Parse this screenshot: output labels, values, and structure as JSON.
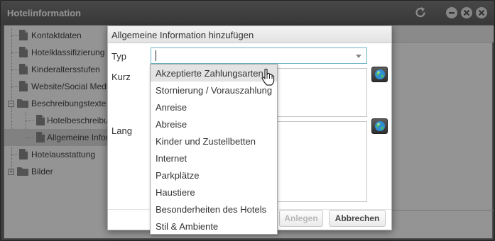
{
  "window": {
    "title": "Hotelinformation"
  },
  "tree": {
    "items": [
      {
        "label": "Kontaktdaten"
      },
      {
        "label": "Hotelklassifizierung"
      },
      {
        "label": "Kinderaltersstufen"
      },
      {
        "label": "Website/Social Media"
      },
      {
        "label": "Beschreibungstexte"
      },
      {
        "label": "Hotelbeschreibung"
      },
      {
        "label": "Allgemeine Informationen"
      },
      {
        "label": "Hotelausstattung"
      },
      {
        "label": "Bilder"
      }
    ]
  },
  "dialog": {
    "title": "Allgemeine Information hinzufügen",
    "type_label": "Typ",
    "type_value": "",
    "short_label": "Kurz",
    "long_label": "Lang",
    "create_button": "Anlegen",
    "cancel_button": "Abbrechen"
  },
  "dropdown": {
    "options": [
      "Akzeptierte Zahlungsarten",
      "Stornierung / Vorauszahlung",
      "Anreise",
      "Abreise",
      "Kinder und Zustellbetten",
      "Internet",
      "Parkplätze",
      "Haustiere",
      "Besonderheiten des Hotels",
      "Stil & Ambiente"
    ],
    "hovered_index": 0
  },
  "icons": {
    "refresh": "refresh-icon",
    "minimize": "minimize-icon",
    "restore": "restore-icon",
    "close": "close-icon",
    "globe": "globe-icon",
    "document": "document-icon",
    "folder": "folder-icon",
    "cursor": "hand-cursor-icon"
  },
  "colors": {
    "titlebar": "#6b6b6b",
    "combo_focus_border": "#69b3c8",
    "hover_row": "#e3e3e3"
  }
}
